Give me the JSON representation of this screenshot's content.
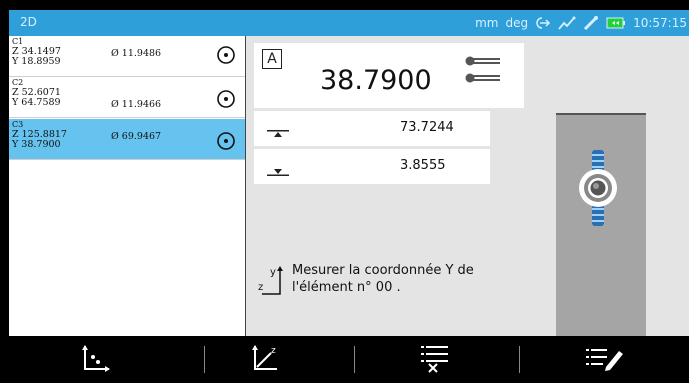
{
  "status_bar": {
    "title": "2D",
    "units_length": "mm",
    "units_angle": "deg",
    "time": "10:57:15"
  },
  "elements": [
    {
      "name": "C1",
      "z": "Z 34.1497",
      "y": "Y 18.8959",
      "diameter": "Ø 11.9486",
      "icon": "circle-point-icon",
      "selected": false
    },
    {
      "name": "C2",
      "z": "Z 52.6071",
      "y": "Y 64.7589",
      "diameter": "Ø 11.9466",
      "icon": "circle-point-icon",
      "selected": false
    },
    {
      "name": "C3",
      "z": "Z 125.8817",
      "y": "Y 38.7900",
      "diameter": "Ø 69.9467",
      "icon": "circle-point-icon",
      "selected": true
    }
  ],
  "measurement": {
    "mode_label": "A",
    "main_value": "38.7900",
    "upper_tolerance": "73.7244",
    "lower_tolerance": "3.8555"
  },
  "instruction": {
    "axis_y": "y",
    "axis_z": "z",
    "line1": "Mesurer la coordonnée Y de",
    "line2": "l'élément n° 00 ."
  },
  "toolbar": {
    "items": [
      "coordinate-origin-icon",
      "coordinate-z-icon",
      "delete-list-icon",
      "edit-list-icon"
    ]
  },
  "colors": {
    "accent": "#2e9fd9",
    "selected_row": "#66c3ef",
    "panel_bg": "#e4e4e4",
    "tool_gray": "#a5a5a5"
  }
}
